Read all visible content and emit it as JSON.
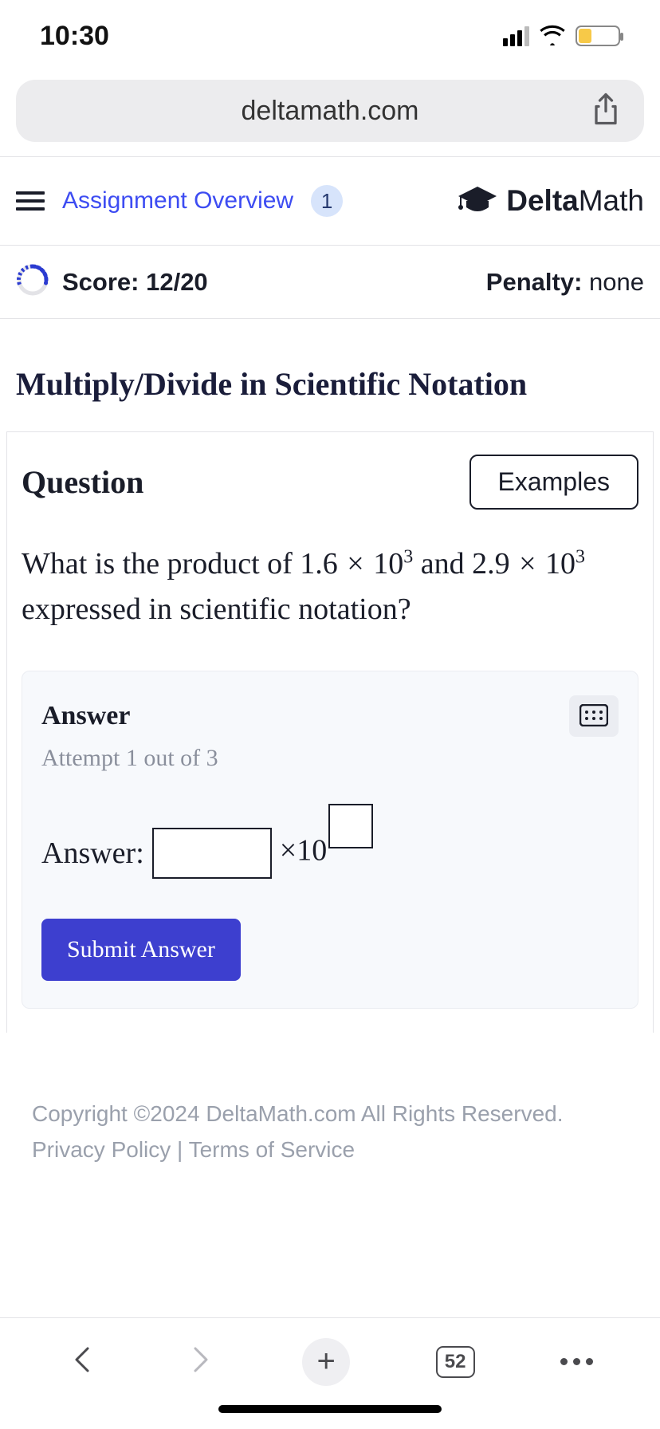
{
  "status": {
    "time": "10:30"
  },
  "address": {
    "url": "deltamath.com"
  },
  "header": {
    "overview_label": "Assignment Overview",
    "badge": "1",
    "logo_bold": "Delta",
    "logo_light": "Math"
  },
  "score": {
    "label": "Score: 12/20",
    "penalty_label": "Penalty:",
    "penalty_value": "none"
  },
  "topic": {
    "title": "Multiply/Divide in Scientific Notation"
  },
  "question": {
    "label": "Question",
    "examples_label": "Examples",
    "prefix": "What is the product of ",
    "num1_coef": "1.6",
    "num1_exp": "3",
    "mid": " and ",
    "num2_coef": "2.9",
    "num2_exp": "3",
    "suffix": " expressed in scientific notation?"
  },
  "answer": {
    "label": "Answer",
    "attempt": "Attempt 1 out of 3",
    "prompt": "Answer:",
    "times10": "×10",
    "submit": "Submit Answer"
  },
  "footer": {
    "copyright": "Copyright ©2024 DeltaMath.com All Rights Reserved.",
    "privacy": "Privacy Policy",
    "sep": " | ",
    "terms": "Terms of Service"
  },
  "browser": {
    "tab_count": "52"
  }
}
